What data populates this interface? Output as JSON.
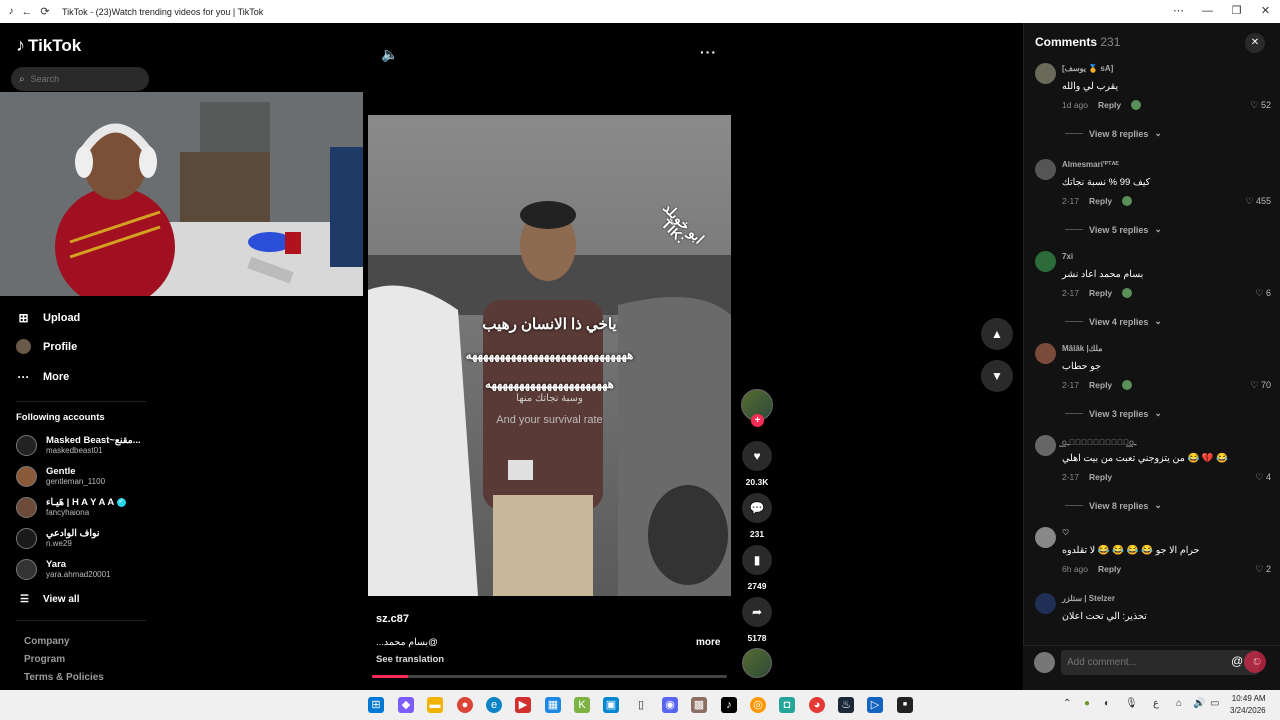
{
  "window": {
    "title": "TikTok - (23)Watch trending videos for you | TikTok",
    "back": "←",
    "refresh": "⟳",
    "menu": "⋯",
    "minimize": "—",
    "restore": "❐",
    "close": "✕"
  },
  "sidebar": {
    "logo": "TikTok",
    "search_placeholder": "Search",
    "nav": [
      {
        "label": "Upload",
        "icon": "upload-icon"
      },
      {
        "label": "Profile",
        "icon": "avatar"
      },
      {
        "label": "More",
        "icon": "more-icon"
      }
    ],
    "following_title": "Following accounts",
    "accounts": [
      {
        "name": "Masked Beast~مقنع...",
        "username": "maskedbeast01"
      },
      {
        "name": "Gentle",
        "username": "gentleman_1100"
      },
      {
        "name": "هَيـاء | H A Y A A",
        "username": "fancyhaiona",
        "verified": true
      },
      {
        "name": "نواف الوادعي",
        "username": "n.we29"
      },
      {
        "name": "Yara",
        "username": "yara.ahmad20001"
      }
    ],
    "view_all": "View all",
    "footer": [
      "Company",
      "Program",
      "Terms & Policies"
    ]
  },
  "video": {
    "overlay_lines": [
      "ياخي ذا الانسان رهيب",
      "هههههههههههههههههههههههههههههه",
      "ههههههههههههههههههههههه",
      "وسبة نجاتك منها",
      "And your survival rate"
    ],
    "watermark": "ابو خويلد",
    "watermark_brand": "TIK:",
    "author": "sz.c87",
    "caption": "...بسام محمد@",
    "more_label": "more",
    "see_translation": "See translation",
    "progress": 0.1
  },
  "actions": {
    "likes": "20.3K",
    "comments": "231",
    "saves": "2749",
    "shares": "5178"
  },
  "comments": {
    "title": "Comments",
    "count": "231",
    "items": [
      {
        "user": "[يوسف 🏅 sA]",
        "text": "يقرب لي والله",
        "date": "1d ago",
        "reply": "Reply",
        "likes": "52",
        "replies": "View 8 replies"
      },
      {
        "user": "Almesmari'ᴾᵀᴬᴱ",
        "text": "كيف 99 % نسبة نجاتك",
        "date": "2-17",
        "reply": "Reply",
        "likes": "455",
        "replies": "View 5 replies"
      },
      {
        "user": "7xi",
        "text": "بسام محمد اعاد نشر",
        "date": "2-17",
        "reply": "Reply",
        "likes": "6",
        "replies": "View 4 replies"
      },
      {
        "user": "Mâlâk |ملك",
        "text": "جو حطاب",
        "date": "2-17",
        "reply": "Reply",
        "likes": "70",
        "replies": "View 3 replies"
      },
      {
        "user": "ـ꯭𝆺꯭𝅥𝙇꯭𝘼꯭𝙉꯭𝘿ـ꯭",
        "text": "من يتزوجني تعبت من بيت اهلي 😂 💔 😂",
        "date": "2-17",
        "reply": "Reply",
        "likes": "4",
        "replies": "View 8 replies"
      },
      {
        "user": "♡",
        "text": "حرام الا جو 😂 😂 😂 😂 لا تقلدوه",
        "date": "6h ago",
        "reply": "Reply",
        "likes": "2",
        "replies": ""
      },
      {
        "user": "ستلزر | Stelzer",
        "text": "تحذير: الي تحت اعلان",
        "date": "",
        "reply": "",
        "likes": "",
        "replies": ""
      }
    ],
    "add_placeholder": "Add comment..."
  },
  "taskbar": {
    "time": "10:49 AM",
    "date": "3/24/2026",
    "lang": "ع"
  },
  "colors": {
    "accent": "#fe2c55",
    "panel": "#121212",
    "verified": "#20d5ec"
  }
}
